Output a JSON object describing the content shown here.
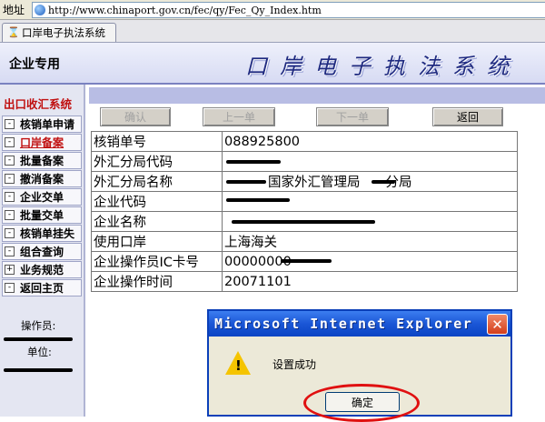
{
  "address_bar": {
    "label": "地址",
    "url": "http://www.chinaport.gov.cn/fec/qy/Fec_Qy_Index.htm"
  },
  "tab": {
    "title": "口岸电子执法系统"
  },
  "banner": {
    "left_text": "企业专用",
    "title": "口岸电子执法系统"
  },
  "sidebar": {
    "heading": "出口收汇系统",
    "items": [
      {
        "label": "核销单申请",
        "expander": "-",
        "active": false
      },
      {
        "label": "口岸备案",
        "expander": "-",
        "active": true
      },
      {
        "label": "批量备案",
        "expander": "-",
        "active": false
      },
      {
        "label": "撤消备案",
        "expander": "-",
        "active": false
      },
      {
        "label": "企业交单",
        "expander": "-",
        "active": false
      },
      {
        "label": "批量交单",
        "expander": "-",
        "active": false
      },
      {
        "label": "核销单挂失",
        "expander": "-",
        "active": false
      },
      {
        "label": "组合查询",
        "expander": "-",
        "active": false
      },
      {
        "label": "业务规范",
        "expander": "+",
        "active": false
      },
      {
        "label": "返回主页",
        "expander": "-",
        "active": false
      }
    ],
    "operator_label": "操作员:",
    "unit_label": "单位:"
  },
  "toolbar": {
    "confirm": "确认",
    "previous": "上一单",
    "next": "下一单",
    "back": "返回"
  },
  "info_table": {
    "rows": [
      {
        "key": "核销单号",
        "value": "088925800"
      },
      {
        "key": "外汇分局代码",
        "value": ""
      },
      {
        "key": "外汇分局名称",
        "value": "国家外汇管理局"
      },
      {
        "key": "企业代码",
        "value": ""
      },
      {
        "key": "企业名称",
        "value": ""
      },
      {
        "key": "使用口岸",
        "value": "上海海关"
      },
      {
        "key": "企业操作员IC卡号",
        "value": "00000000"
      },
      {
        "key": "企业操作时间",
        "value": "20071101"
      }
    ],
    "branch_suffix": "分局"
  },
  "dialog": {
    "title": "Microsoft Internet Explorer",
    "message": "设置成功",
    "ok": "确定",
    "close_glyph": "✕"
  }
}
